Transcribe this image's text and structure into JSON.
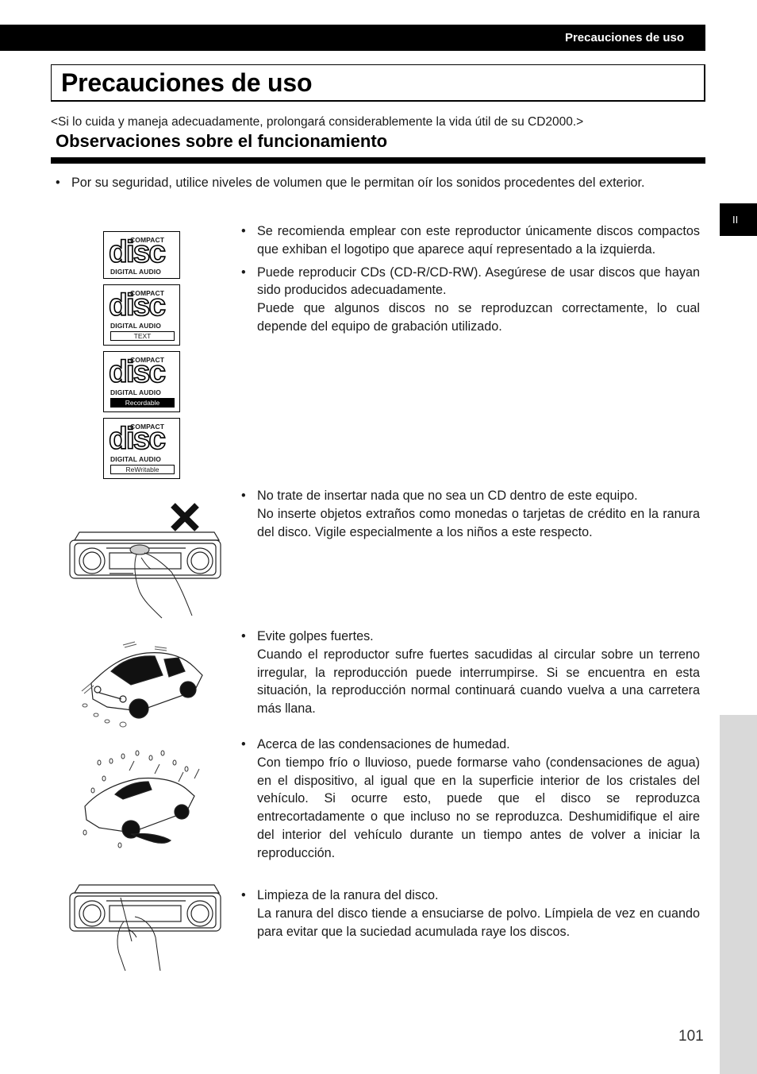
{
  "header": {
    "running_title": "Precauciones de uso"
  },
  "page": {
    "title": "Precauciones de uso",
    "intro": "<Si lo cuida y maneja adecuadamente, prolongará considerablemente la vida útil de su CD2000.>",
    "section_heading": "Observaciones sobre el funcionamiento",
    "side_tab_label": "II",
    "page_number": "101"
  },
  "cd_logos": [
    {
      "top": "COMPACT",
      "main": "disc",
      "bottom": "DIGITAL AUDIO",
      "sub": ""
    },
    {
      "top": "COMPACT",
      "main": "disc",
      "bottom": "DIGITAL AUDIO",
      "sub": "TEXT"
    },
    {
      "top": "COMPACT",
      "main": "disc",
      "bottom": "DIGITAL AUDIO",
      "sub": "Recordable"
    },
    {
      "top": "COMPACT",
      "main": "disc",
      "bottom": "DIGITAL AUDIO",
      "sub": "ReWritable"
    }
  ],
  "bullets": [
    {
      "paragraphs": [
        "Por su seguridad, utilice niveles de volumen que le permitan oír los sonidos procedentes del exterior."
      ]
    },
    {
      "paragraphs": [
        "Se recomienda emplear con este reproductor únicamente discos compactos que exhiban el logotipo que aparece aquí representado a la izquierda."
      ]
    },
    {
      "paragraphs": [
        "Puede reproducir CDs (CD-R/CD-RW). Asegúrese de usar discos que hayan sido producidos adecuadamente.",
        "Puede que algunos discos no se reproduzcan correctamente, lo cual depende del equipo de grabación utilizado."
      ]
    },
    {
      "paragraphs": [
        "No trate de insertar nada que no sea un CD dentro de este equipo.",
        "No inserte objetos extraños como monedas o tarjetas de crédito en la ranura del disco. Vigile especialmente a los niños a este respecto."
      ]
    },
    {
      "paragraphs": [
        "Evite golpes fuertes.",
        "Cuando el reproductor sufre fuertes sacudidas al circular sobre un terreno irregular, la reproducción puede interrumpirse. Si se encuentra en esta situación, la reproducción normal continuará cuando vuelva a una carretera más llana."
      ]
    },
    {
      "paragraphs": [
        "Acerca de las condensaciones de humedad.",
        "Con tiempo frío o lluvioso, puede formarse vaho (condensaciones de agua) en el dispositivo, al igual que en la superficie interior de los cristales del vehículo. Si ocurre esto, puede que el disco se reproduzca entrecortadamente o que incluso no se reproduzca. Deshumidifique el aire del interior del vehículo durante un tiempo antes de volver a iniciar la reproducción."
      ]
    },
    {
      "paragraphs": [
        "Limpieza de la ranura del disco.",
        "La ranura del disco tiende a ensuciarse de polvo. Límpiela de vez en cuando para evitar que la suciedad acumulada raye los discos."
      ]
    }
  ],
  "illustrations": {
    "coin_insert": "car-stereo-coin-prohibited-illustration",
    "bumpy_car": "car-shaking-illustration",
    "rain_car": "car-in-rain-condensation-illustration",
    "cleaning": "car-stereo-slot-cleaning-illustration"
  }
}
